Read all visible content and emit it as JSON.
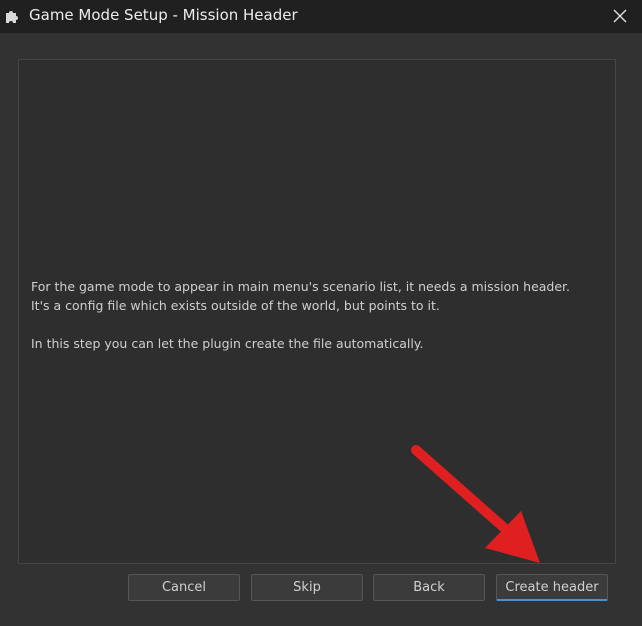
{
  "window": {
    "title": "Game Mode Setup - Mission Header",
    "icon": "puzzle-icon",
    "close_icon": "close-icon"
  },
  "content": {
    "line1": "For the game mode to appear in main menu's scenario list, it needs a mission header.",
    "line2": "It's a config file which exists outside of the world, but points to it.",
    "line3": "In this step you can let the plugin create the file automatically."
  },
  "buttons": {
    "cancel": "Cancel",
    "skip": "Skip",
    "back": "Back",
    "create": "Create header"
  },
  "colors": {
    "accent": "#4a8fd8",
    "annotation_arrow": "#e02020"
  }
}
